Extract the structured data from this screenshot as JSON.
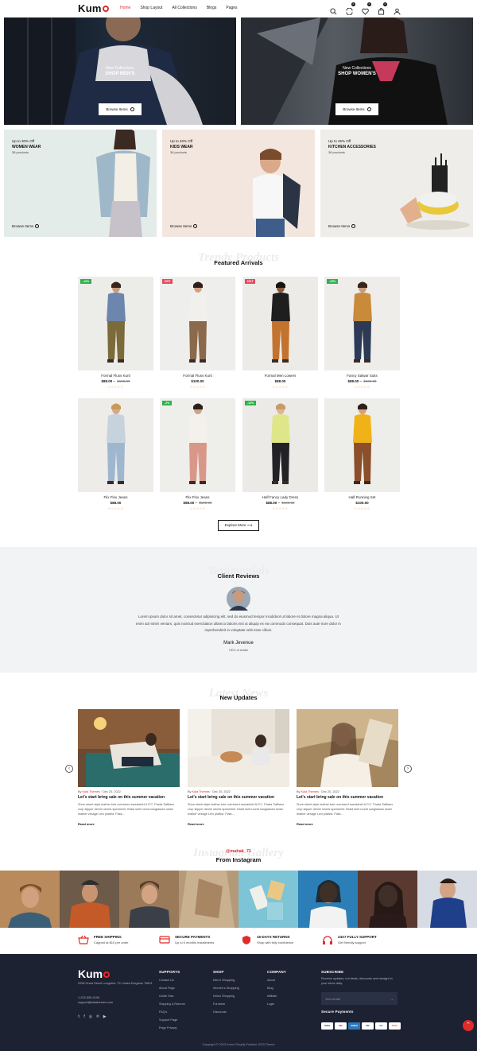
{
  "header": {
    "logo": "Kum",
    "nav": [
      "Home",
      "Shop Layout",
      "All Collections",
      "Blogs",
      "Pages"
    ],
    "cart_counts": [
      "0",
      "0",
      "0"
    ]
  },
  "hero": [
    {
      "subtitle": "New Collections",
      "title": "SHOP MEN'S",
      "button": "Browse Items"
    },
    {
      "subtitle": "New Collections",
      "title": "SHOP WOMEN'S",
      "button": "Browse Items"
    }
  ],
  "promos": [
    {
      "offer": "Up to 30% Off",
      "title": "WOMEN WEAR",
      "count": "38 products",
      "link": "Browse Items"
    },
    {
      "offer": "Up to 40% Off",
      "title": "KIDS WEAR",
      "count": "38 products",
      "link": "Browse Items"
    },
    {
      "offer": "Up to 45% Off",
      "title": "KITCHEN ACCESSORIES",
      "count": "38 products",
      "link": "Browse Items"
    }
  ],
  "featured": {
    "ghost": "Trendy Products",
    "title": "Featured Arrivals",
    "products": [
      {
        "tag": "-12%",
        "name": "Formal Fluss Kurti",
        "price": "$88.00",
        "old": "$100.00"
      },
      {
        "tag": "HOT",
        "name": "Formal Fluss Kurti",
        "price": "$100.00",
        "old": ""
      },
      {
        "tag": "HOT",
        "name": "Formal Men Lowers",
        "price": "$88.00",
        "old": ""
      },
      {
        "tag": "-12%",
        "name": "Fancy Salwar Suits",
        "price": "$88.00",
        "old": "$100.00"
      },
      {
        "tag": "",
        "name": "Flix Flox Jeans",
        "price": "$88.00",
        "old": ""
      },
      {
        "tag": "-2%",
        "name": "Flix Flox Jeans",
        "price": "$98.00",
        "old": "$100.00"
      },
      {
        "tag": "-12%",
        "name": "Half Fancy Lady Dress",
        "price": "$88.00",
        "old": "$100.00"
      },
      {
        "tag": "",
        "name": "Half Running Set",
        "price": "$100.00",
        "old": ""
      }
    ],
    "stars": "☆☆☆☆☆",
    "explore": "Explore More ⟶"
  },
  "reviews": {
    "ghost": "Testimonials",
    "title": "Client Reviews",
    "text": "Lorem ipsum dolor sit amet, consectetur adipisicing elit, sed do eiusmod tempor incididunt ut labore et dolore magna aliqua. Ut enim ad minim veniam, quis nostrud exercitation ullamco laboris nisi ut aliquip ex ea commodo consequat. Duis aute irure dolor in reprehenderit in voluptate velit esse cillum.",
    "name": "Mark Jevenue",
    "role": "CEO of Addle"
  },
  "blog": {
    "ghost": "Latest News",
    "title": "New Updates",
    "posts": [
      {
        "author": "Kala Themes",
        "date": "Dec 20, 2022",
        "title": "Let's start bring sale on this summer vacation",
        "excerpt": "Shoe street style leather tote oversized sweatshirt A.P.C. Prada Saffiano crop slipper denim shorts spearmint. Braid skirt round sunglasses seam leather vintage Levi plaited. Flats…",
        "read": "Read more"
      },
      {
        "author": "Kala Themes",
        "date": "Dec 20, 2022",
        "title": "Let's start bring sale on this summer vacation",
        "excerpt": "Shoe street style leather tote oversized sweatshirt A.P.C. Prada Saffiano crop slipper denim shorts spearmint. Braid skirt round sunglasses seam leather vintage Levi plaited. Flats…",
        "read": "Read more"
      },
      {
        "author": "Kala Themes",
        "date": "Dec 20, 2022",
        "title": "Let's start bring sale on this summer vacation",
        "excerpt": "Shoe street style leather tote oversized sweatshirt A.P.C. Prada Saffiano crop slipper denim shorts spearmint. Braid skirt round sunglasses seam leather vintage Levi plaited. Flats…",
        "read": "Read more"
      }
    ],
    "by": "By "
  },
  "instagram": {
    "ghost": "Instagram Gallery",
    "handle": "@mahak_71",
    "title": "From Instagram"
  },
  "features": [
    {
      "title": "FREE SHIPPING",
      "sub": "Capped at $10 per order"
    },
    {
      "title": "SECURE PAYMENTS",
      "sub": "Up to 6 months installments"
    },
    {
      "title": "15-DAYS RETURNS",
      "sub": "Shop with fully confidence"
    },
    {
      "title": "24X7 FULLY SUPPORT",
      "sub": "Get friendly support"
    }
  ],
  "footer": {
    "logo": "Kum",
    "address": "2298 Grant Street Longview, TX United Kingdom 75601",
    "phone": "1-202-555-0106",
    "email": "support@kalathemes.com",
    "support_title": "SUPPORTS",
    "support": [
      "Contact Us",
      "About Page",
      "Guide Size",
      "Shipping & Returns",
      "FAQ's",
      "Support Page",
      "Page Privacy"
    ],
    "shop_title": "SHOP",
    "shop": [
      "Men's Shopping",
      "Women's Shopping",
      "Kids's Shopping",
      "Furniture",
      "Discounts"
    ],
    "company_title": "COMPANY",
    "company": [
      "About",
      "Blog",
      "Affiliate",
      "Login"
    ],
    "subscribe_title": "SUBSCRIBE",
    "subscribe_text": "Receive updates, hot deals, discounts sent straignt in your inbox daily",
    "email_placeholder": "Your email",
    "secure_title": "Secure Payments",
    "payments": [
      "VISA",
      "MC",
      "AMEX",
      "PP",
      "DC",
      "DISC"
    ],
    "copyright": "Copyright © 2023 Kumo Shopify Fashion 2023 Theme"
  }
}
